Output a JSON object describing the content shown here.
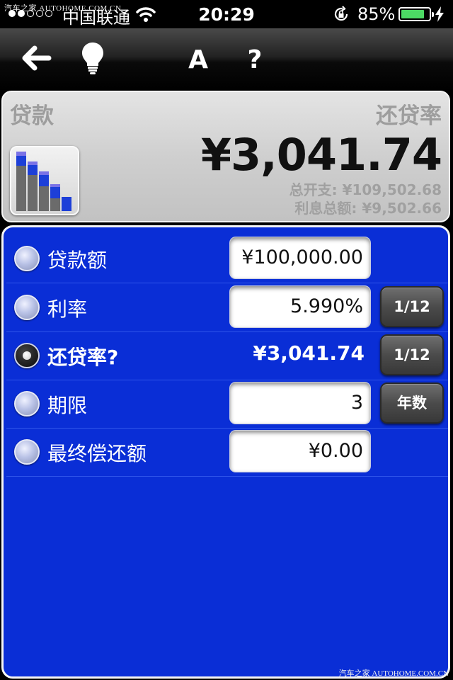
{
  "status_bar": {
    "watermark": "汽车之家 AUTOHOME.COM.CN",
    "carrier": "中国联通",
    "time": "20:29",
    "battery_percent": "85%",
    "battery_level": 0.85
  },
  "toolbar": {
    "back_icon": "arrow-left",
    "tip_icon": "lightbulb",
    "font_label": "A",
    "help_label": "?"
  },
  "summary": {
    "left_title": "贷款",
    "right_title": "还贷率",
    "payment_amount": "¥3,041.74",
    "total_cost": "总开支: ¥109,502.68",
    "total_interest": "利息总额: ¥9,502.66"
  },
  "form": {
    "rows": [
      {
        "label": "贷款额",
        "value": "¥100,000.00",
        "selected": false
      },
      {
        "label": "利率",
        "value": "5.990%",
        "unit_button": "1/12",
        "selected": false
      },
      {
        "label": "还贷率?",
        "value": "¥3,041.74",
        "unit_button": "1/12",
        "selected": true
      },
      {
        "label": "期限",
        "value": "3",
        "unit_button": "年数",
        "selected": false
      },
      {
        "label": "最终偿还额",
        "value": "¥0.00",
        "selected": false
      }
    ]
  },
  "footer": {
    "watermark": "汽车之家 AUTOHOME.COM.CN"
  },
  "colors": {
    "panel_blue": "#0a2ed6",
    "battery_green": "#4cd964"
  }
}
